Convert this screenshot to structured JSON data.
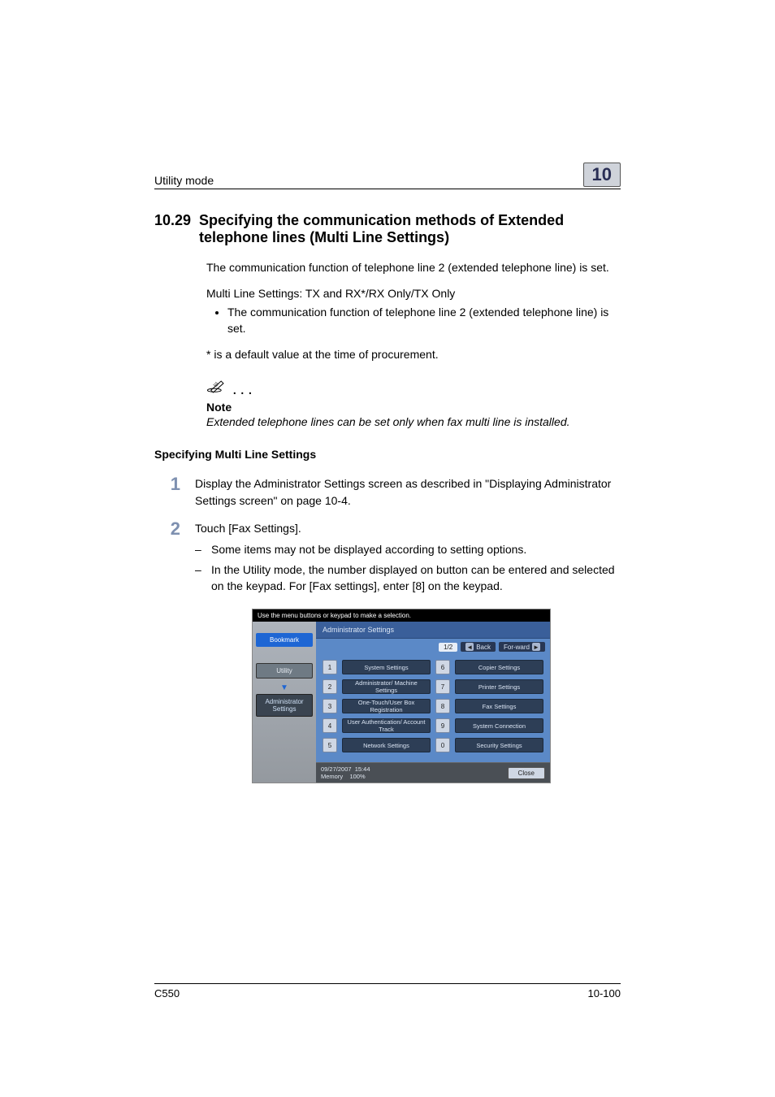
{
  "header": {
    "running_title": "Utility mode",
    "chapter_number": "10"
  },
  "section": {
    "number": "10.29",
    "title": "Specifying the communication methods of Extended telephone lines (Multi Line Settings)"
  },
  "paragraphs": {
    "p1": "The communication function of telephone line 2 (extended telephone line) is set.",
    "p2": "Multi Line Settings: TX and RX*/RX Only/TX Only",
    "bullet1": "The communication function of telephone line 2 (extended telephone line) is set.",
    "p3": "* is a default value at the time of procurement."
  },
  "note": {
    "label": "Note",
    "text": "Extended telephone lines can be set only when fax multi line is installed."
  },
  "subhead": "Specifying Multi Line Settings",
  "steps": [
    {
      "num": "1",
      "text": "Display the Administrator Settings screen as described in \"Displaying Administrator Settings screen\" on page 10-4.",
      "dashes": []
    },
    {
      "num": "2",
      "text": "Touch [Fax Settings].",
      "dashes": [
        "Some items may not be displayed according to setting options.",
        "In the Utility mode, the number displayed on button can be entered and selected on the keypad. For [Fax settings], enter [8] on the keypad."
      ]
    }
  ],
  "screenshot": {
    "top_hint": "Use the menu buttons or keypad to make a selection.",
    "side": {
      "bookmark": "Bookmark",
      "utility": "Utility",
      "admin": "Administrator Settings"
    },
    "main_title": "Administrator Settings",
    "toolbar": {
      "page": "1/2",
      "back": "Back",
      "forward": "For-ward"
    },
    "buttons": [
      {
        "n": "1",
        "label": "System Settings"
      },
      {
        "n": "2",
        "label": "Administrator/ Machine Settings"
      },
      {
        "n": "3",
        "label": "One-Touch/User Box Registration"
      },
      {
        "n": "4",
        "label": "User Authentication/ Account Track"
      },
      {
        "n": "5",
        "label": "Network Settings"
      },
      {
        "n": "6",
        "label": "Copier Settings"
      },
      {
        "n": "7",
        "label": "Printer Settings"
      },
      {
        "n": "8",
        "label": "Fax Settings"
      },
      {
        "n": "9",
        "label": "System Connection"
      },
      {
        "n": "0",
        "label": "Security Settings"
      }
    ],
    "footer": {
      "date": "09/27/2007",
      "time": "15:44",
      "memory_label": "Memory",
      "memory_value": "100%",
      "close": "Close"
    }
  },
  "footer": {
    "model": "C550",
    "page": "10-100"
  }
}
